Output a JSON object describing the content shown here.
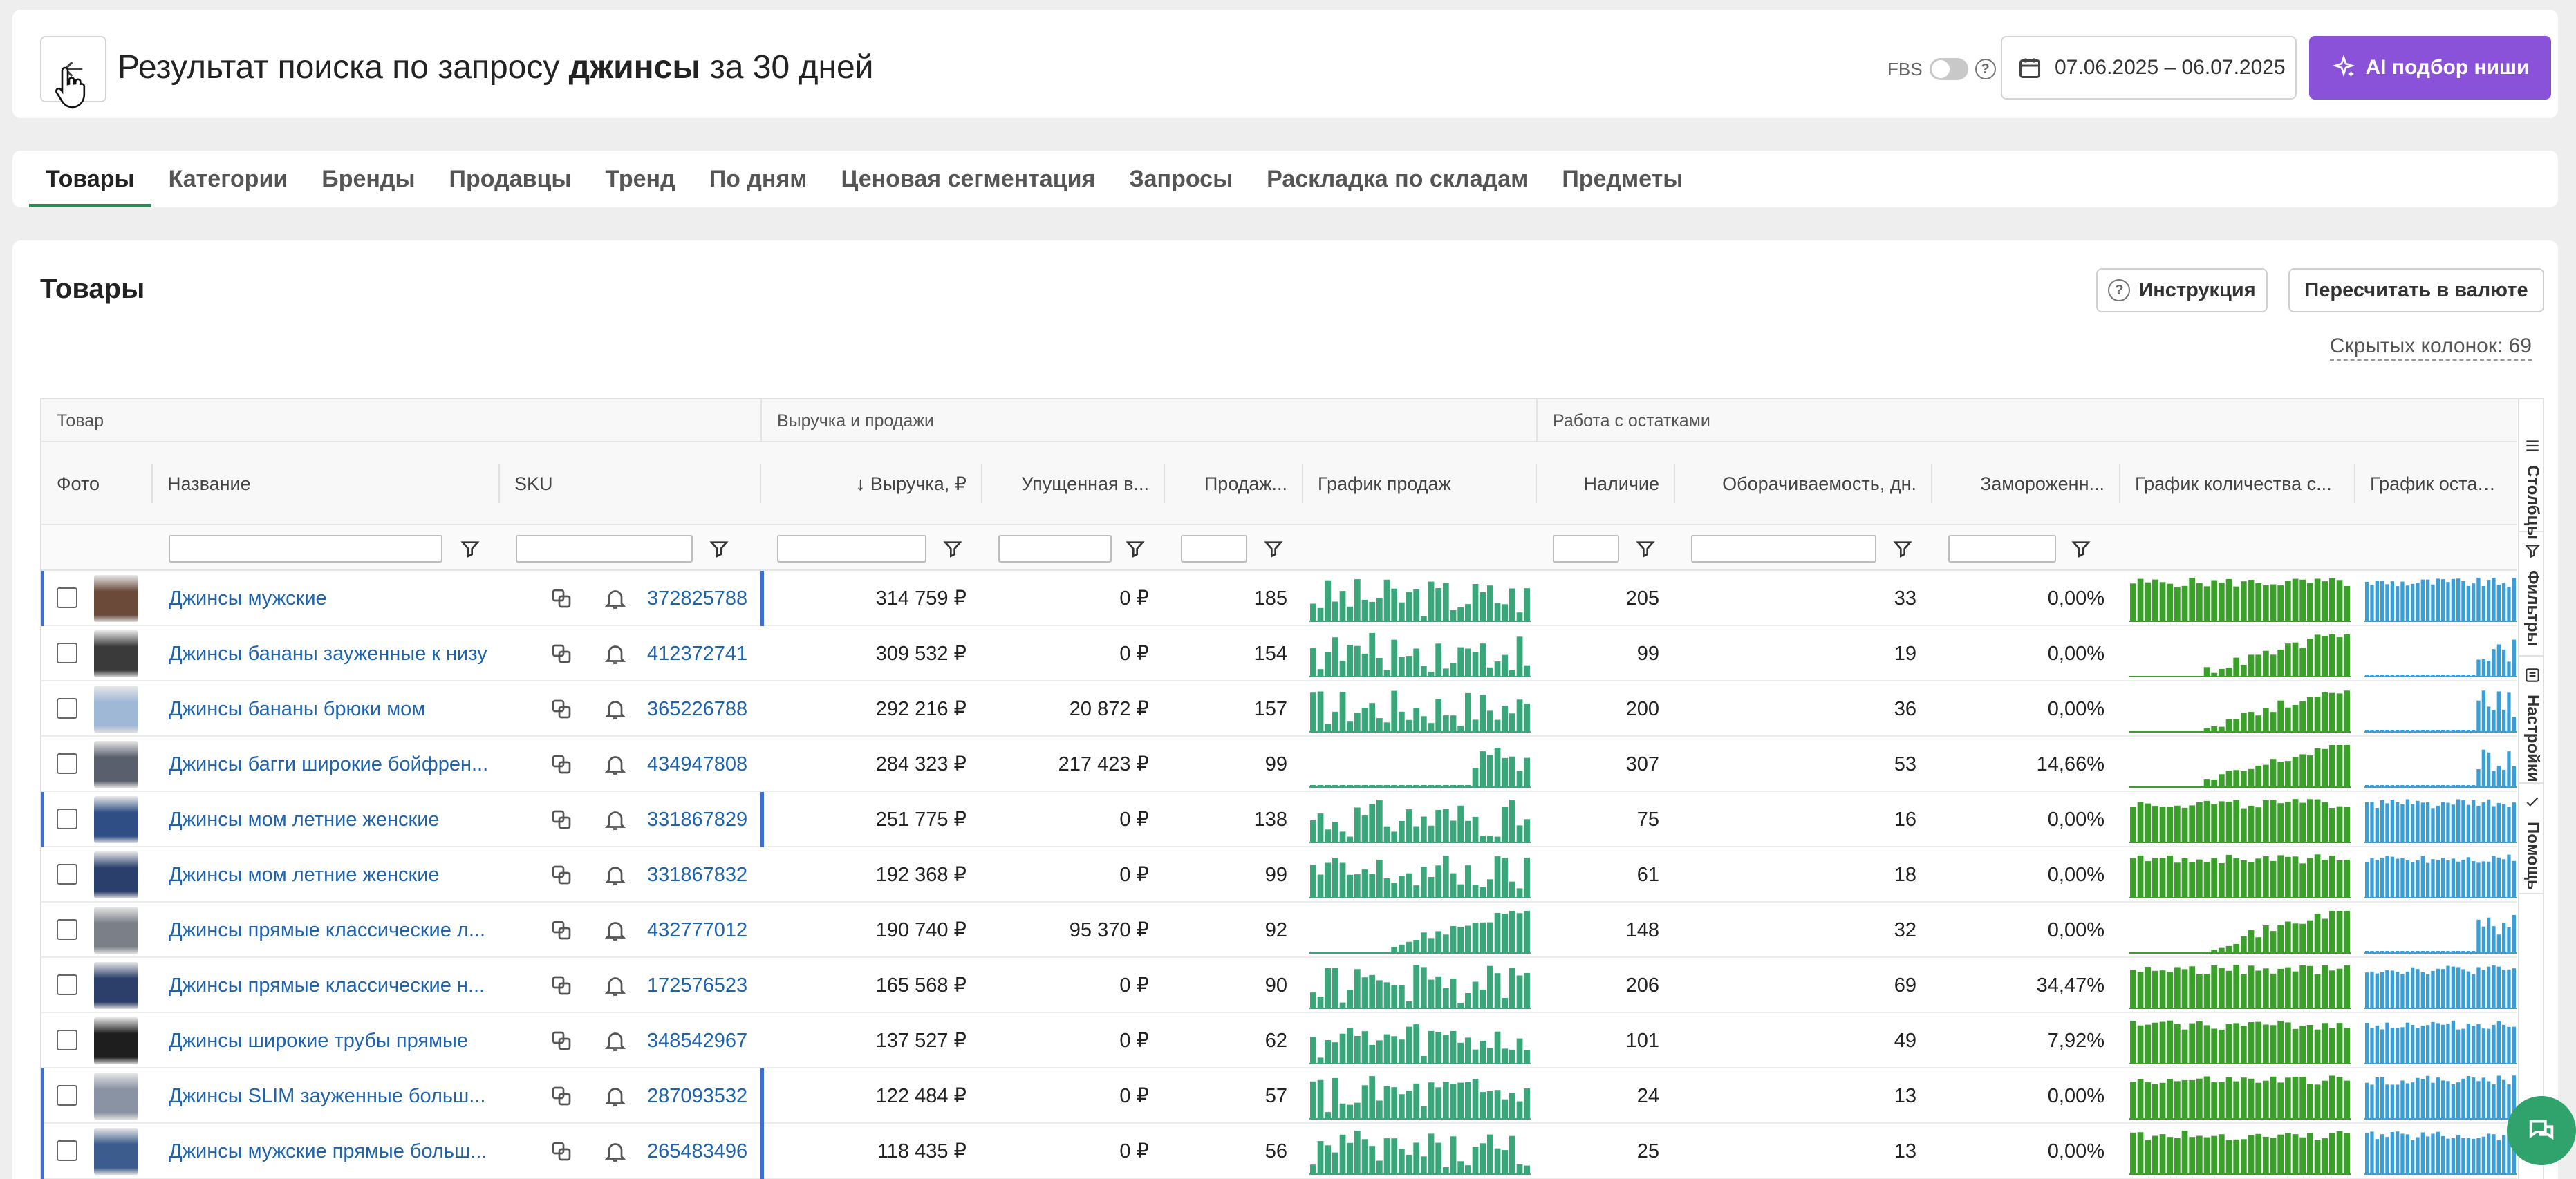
{
  "header": {
    "title_prefix": "Результат поиска по запросу",
    "title_query": "джинсы",
    "title_suffix": "за 30 дней",
    "fbs_label": "FBS",
    "date_range": "07.06.2025 – 06.07.2025",
    "ai_button": "AI подбор ниши"
  },
  "tabs": [
    "Товары",
    "Категории",
    "Бренды",
    "Продавцы",
    "Тренд",
    "По дням",
    "Ценовая сегментация",
    "Запросы",
    "Раскладка по складам",
    "Предметы"
  ],
  "section": {
    "title": "Товары",
    "instruction_button": "Инструкция",
    "convert_button": "Пересчитать в валюте",
    "hidden_columns": "Скрытых колонок: 69"
  },
  "grid": {
    "groups": {
      "product": "Товар",
      "revenue": "Выручка и продажи",
      "stock": "Работа с остатками"
    },
    "columns": {
      "photo": "Фото",
      "name": "Название",
      "sku": "SKU",
      "revenue": "↓ Выручка, ₽",
      "lost": "Упущенная в...",
      "sales": "Продаж...",
      "sales_chart": "График продаж",
      "stock": "Наличие",
      "turnover": "Оборачиваемость, дн.",
      "frozen": "Замороженн...",
      "stock_qty_chart": "График количества с...",
      "stock_chart": "График остатков"
    },
    "side_tabs": [
      "Столбцы",
      "Фильтры",
      "Настройки",
      "Помощь"
    ],
    "rows": [
      {
        "name": "Джинсы мужские",
        "sku": "372825788",
        "revenue": "314 759 ₽",
        "lost": "0 ₽",
        "sales": "185",
        "stock": "205",
        "turnover": "33",
        "frozen": "0,00%",
        "marked": true,
        "photo_color": "#6b4a3a"
      },
      {
        "name": "Джинсы бананы зауженные к низу",
        "sku": "412372741",
        "revenue": "309 532 ₽",
        "lost": "0 ₽",
        "sales": "154",
        "stock": "99",
        "turnover": "19",
        "frozen": "0,00%",
        "marked": false,
        "photo_color": "#3a3a3a"
      },
      {
        "name": "Джинсы бананы брюки мом",
        "sku": "365226788",
        "revenue": "292 216 ₽",
        "lost": "20 872 ₽",
        "sales": "157",
        "stock": "200",
        "turnover": "36",
        "frozen": "0,00%",
        "marked": false,
        "photo_color": "#9fb8d6"
      },
      {
        "name": "Джинсы багги широкие бойфрен...",
        "sku": "434947808",
        "revenue": "284 323 ₽",
        "lost": "217 423 ₽",
        "sales": "99",
        "stock": "307",
        "turnover": "53",
        "frozen": "14,66%",
        "marked": false,
        "photo_color": "#5a5f6e"
      },
      {
        "name": "Джинсы мом летние женские",
        "sku": "331867829",
        "revenue": "251 775 ₽",
        "lost": "0 ₽",
        "sales": "138",
        "stock": "75",
        "turnover": "16",
        "frozen": "0,00%",
        "marked": true,
        "photo_color": "#2f4e86"
      },
      {
        "name": "Джинсы мом летние женские",
        "sku": "331867832",
        "revenue": "192 368 ₽",
        "lost": "0 ₽",
        "sales": "99",
        "stock": "61",
        "turnover": "18",
        "frozen": "0,00%",
        "marked": false,
        "photo_color": "#2a3f6c"
      },
      {
        "name": "Джинсы прямые классические л...",
        "sku": "432777012",
        "revenue": "190 740 ₽",
        "lost": "95 370 ₽",
        "sales": "92",
        "stock": "148",
        "turnover": "32",
        "frozen": "0,00%",
        "marked": false,
        "photo_color": "#7a7f88"
      },
      {
        "name": "Джинсы прямые классические н...",
        "sku": "172576523",
        "revenue": "165 568 ₽",
        "lost": "0 ₽",
        "sales": "90",
        "stock": "206",
        "turnover": "69",
        "frozen": "34,47%",
        "marked": false,
        "photo_color": "#2c3f6a"
      },
      {
        "name": "Джинсы широкие трубы прямые",
        "sku": "348542967",
        "revenue": "137 527 ₽",
        "lost": "0 ₽",
        "sales": "62",
        "stock": "101",
        "turnover": "49",
        "frozen": "7,92%",
        "marked": false,
        "photo_color": "#1e1e1e"
      },
      {
        "name": "Джинсы SLIM зауженные больш...",
        "sku": "287093532",
        "revenue": "122 484 ₽",
        "lost": "0 ₽",
        "sales": "57",
        "stock": "24",
        "turnover": "13",
        "frozen": "0,00%",
        "marked": true,
        "photo_color": "#8a93a3"
      },
      {
        "name": "Джинсы мужские прямые больш...",
        "sku": "265483496",
        "revenue": "118 435 ₽",
        "lost": "0 ₽",
        "sales": "56",
        "stock": "25",
        "turnover": "13",
        "frozen": "0,00%",
        "marked": true,
        "photo_color": "#3b5c8c"
      }
    ]
  },
  "colors": {
    "accent": "#8a52d8",
    "link": "#1f63ad",
    "sales_bar": "#3aa77a",
    "stock_bar": "#3aa02a",
    "stock2_bar": "#3a9ed8",
    "tab_underline": "#2e8b57"
  },
  "icons": [
    "back-arrow-icon",
    "calendar-icon",
    "sparkle-icon",
    "help-icon",
    "copy-icon",
    "bell-icon",
    "filter-icon",
    "chat-icon",
    "columns-icon",
    "settings-icon"
  ]
}
